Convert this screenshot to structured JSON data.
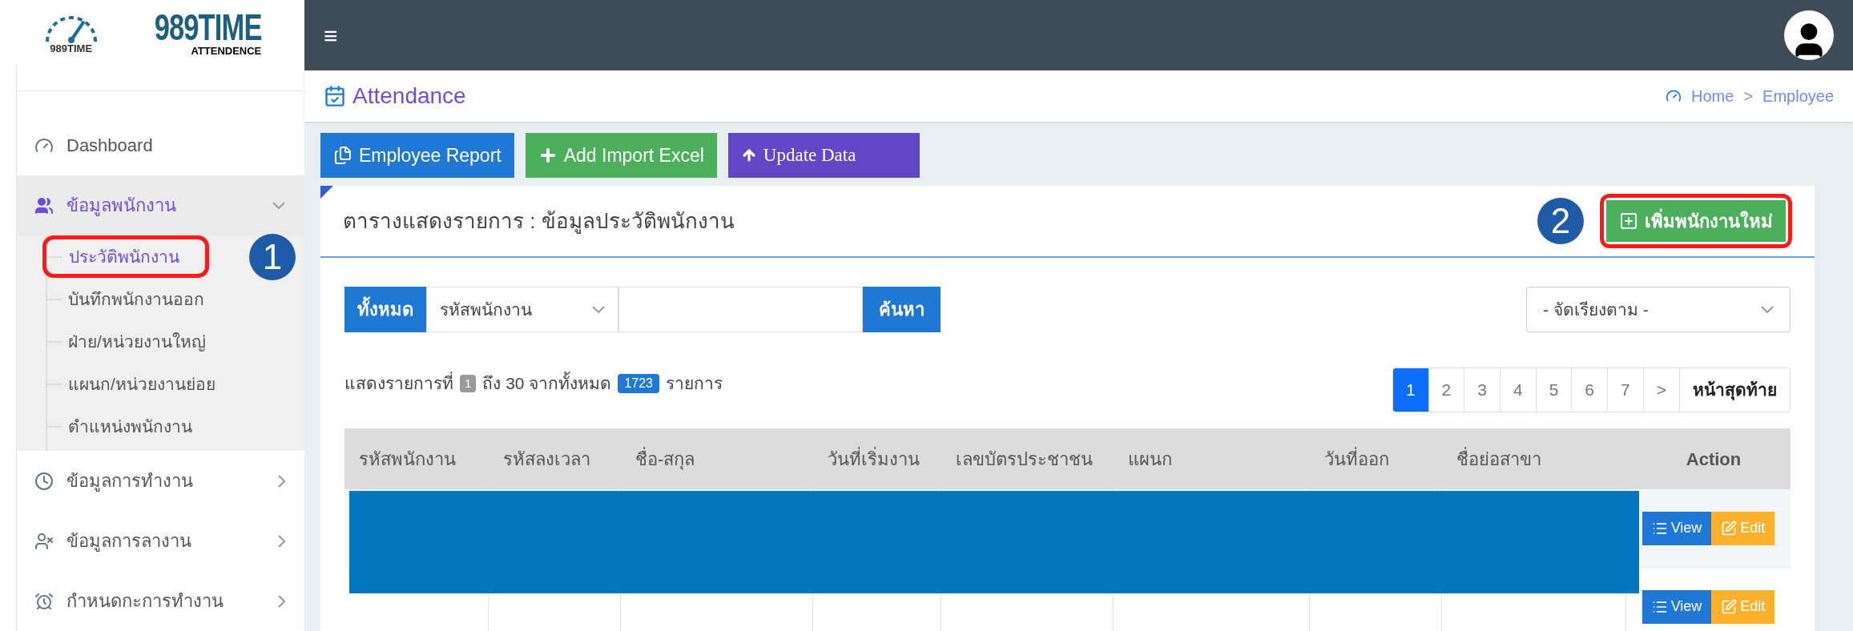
{
  "logo": {
    "icon_caption": "989TIME",
    "name": "989TIME",
    "subtitle": "ATTENDENCE"
  },
  "sidebar": {
    "items": [
      {
        "label": "Dashboard",
        "expanded": false,
        "has_arrow": false
      },
      {
        "label": "ข้อมูลพนักงาน",
        "expanded": true,
        "has_arrow": true,
        "children": [
          {
            "label": "ประวัติพนักงาน",
            "selected": true,
            "annotated": true
          },
          {
            "label": "บันทึกพนักงานออก",
            "selected": false,
            "annotated": false
          },
          {
            "label": "ฝ่าย/หน่วยงานใหญ่",
            "selected": false,
            "annotated": false
          },
          {
            "label": "แผนก/หน่วยงานย่อย",
            "selected": false,
            "annotated": false
          },
          {
            "label": "ตำแหน่งพนักงาน",
            "selected": false,
            "annotated": false
          }
        ]
      },
      {
        "label": "ข้อมูลการทำงาน",
        "expanded": false,
        "has_arrow": true
      },
      {
        "label": "ข้อมูลการลางาน",
        "expanded": false,
        "has_arrow": true
      },
      {
        "label": "กำหนดกะการทำงาน",
        "expanded": false,
        "has_arrow": true
      }
    ]
  },
  "annotations": [
    {
      "number": "1"
    },
    {
      "number": "2"
    }
  ],
  "topbar": {
    "menu_glyph": "≡"
  },
  "page_header": {
    "title": "Attendance",
    "breadcrumb": [
      "Home",
      "Employee"
    ],
    "separator": ">"
  },
  "toolbar": [
    {
      "label": "Employee Report",
      "kind": "report"
    },
    {
      "label": "Add Import Excel",
      "kind": "import"
    },
    {
      "label": "Update Data",
      "kind": "update"
    }
  ],
  "card": {
    "title": "ตารางแสดงรายการ : ข้อมูลประวัติพนักงาน",
    "add_button": "เพิ่มพนักงานใหม่",
    "search": {
      "scope": "ทั้งหมด",
      "field": "รหัสพนักงาน",
      "button": "ค้นหา"
    },
    "sort": {
      "value": "- จัดเรียงตาม -"
    },
    "summary": {
      "prefix": "แสดงรายการที่",
      "from": "1",
      "middle": "ถึง 30 จากทั้งหมด",
      "total": "1723",
      "suffix": "รายการ"
    },
    "pagination": [
      {
        "label": "1",
        "selected": true
      },
      {
        "label": "2",
        "selected": false
      },
      {
        "label": "3",
        "selected": false
      },
      {
        "label": "4",
        "selected": false
      },
      {
        "label": "5",
        "selected": false
      },
      {
        "label": "6",
        "selected": false
      },
      {
        "label": "7",
        "selected": false
      },
      {
        "label": ">",
        "selected": false
      },
      {
        "label": "หน้าสุดท้าย",
        "selected": false
      }
    ],
    "table": {
      "columns": [
        "รหัสพนักงาน",
        "รหัสลงเวลา",
        "ชื่อ-สกุล",
        "วันที่เริ่มงาน",
        "เลขบัตรประชาชน",
        "แผนก",
        "วันที่ออก",
        "ชื่อย่อสาขา",
        "Action"
      ],
      "rows": [
        {
          "view": "View",
          "edit": "Edit"
        },
        {
          "view": "View",
          "edit": "Edit"
        }
      ]
    }
  }
}
